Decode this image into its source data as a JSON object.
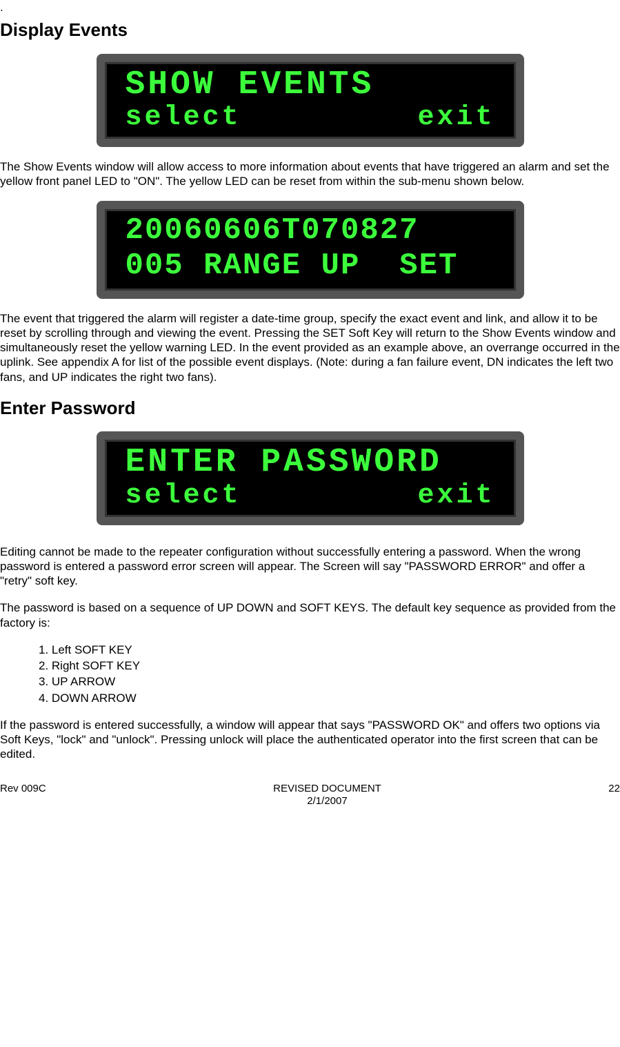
{
  "top_dot": ".",
  "heading1": "Display Events",
  "lcd1": {
    "line1": "SHOW EVENTS",
    "left": "select",
    "right": "exit"
  },
  "para1": "The Show Events window will allow access to more information about events that have triggered an alarm and set the yellow front panel LED to \"ON\".  The yellow LED can be reset from within the sub-menu shown below.",
  "lcd2": {
    "line1": "20060606T070827",
    "line2": "005 RANGE UP  SET"
  },
  "para2": "The event that triggered the alarm will register a date-time group, specify the exact event and link, and allow it to be reset by scrolling through and viewing the event.  Pressing the SET Soft Key will return to the Show Events window and simultaneously reset the yellow warning LED.  In the event provided as an example above, an overrange occurred in the uplink.  See appendix A for list of the possible event displays. (Note: during a fan failure event, DN indicates the left two fans, and UP indicates the right two fans).",
  "heading2": "Enter Password",
  "lcd3": {
    "line1": "ENTER PASSWORD",
    "left": "select",
    "right": "exit"
  },
  "para3": "Editing cannot be made to the repeater configuration without successfully entering a password.  When the wrong password is entered a password error screen will appear.  The Screen will say \"PASSWORD ERROR\" and offer a \"retry\" soft key.",
  "para4": "The password is based on a sequence of UP DOWN and SOFT KEYS.  The default key sequence as provided from the factory is:",
  "list": {
    "i1": "1.   Left SOFT KEY",
    "i2": "2.   Right SOFT KEY",
    "i3": "3.   UP ARROW",
    "i4": "4.   DOWN ARROW"
  },
  "para5": "If the password is entered successfully, a window will appear that says \"PASSWORD OK\" and offers two options via Soft Keys, \"lock\" and \"unlock\".  Pressing unlock will place the authenticated operator into the first screen that can be edited.",
  "footer": {
    "left": "Rev 009C",
    "center1": "REVISED DOCUMENT",
    "center2": "2/1/2007",
    "right": "22"
  }
}
